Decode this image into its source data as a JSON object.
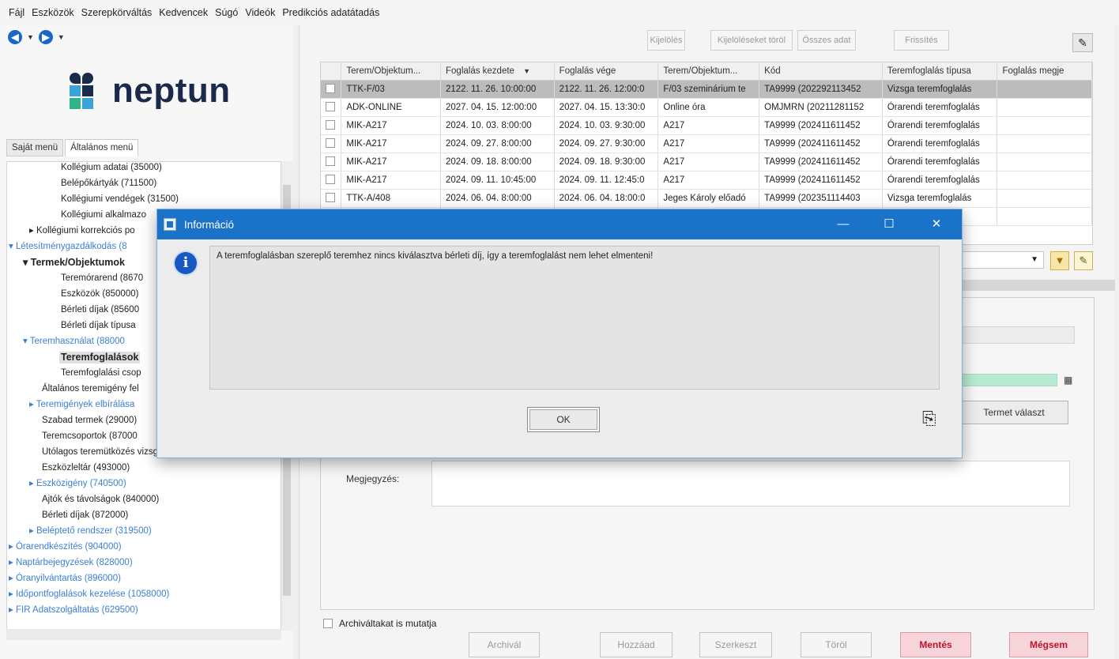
{
  "menubar": {
    "items": [
      "Fájl",
      "Eszközök",
      "Szerepkörváltás",
      "Kedvencek",
      "Súgó",
      "Videók",
      "Predikciós adatátadás"
    ]
  },
  "logo": {
    "text": "neptun"
  },
  "left_tabs": [
    "Saját menü",
    "Általános menü"
  ],
  "tree": {
    "items": [
      "Kollégium adatai (35000)",
      "Belépőkártyák (711500)",
      "Kollégiumi vendégek (31500)",
      "Kollégiumi alkalmazo",
      "Kollégiumi korrekciós po",
      "Létesítménygazdálkodás (8",
      "Termek/Objektumok",
      "Teremórarend (8670",
      "Eszközök (850000)",
      "Bérleti díjak (85600",
      "Bérleti díjak típusa",
      "Teremhasználat (88000",
      "Teremfoglalások",
      "Teremfoglalási csop",
      "Általános teremigény fel",
      "Teremigények elbírálása",
      "Szabad termek (29000)",
      "Teremcsoportok (87000",
      "Utólagos teremütközés vizsgálat (80500)",
      "Eszközleltár (493000)",
      "Eszközigény (740500)",
      "Ajtók és távolságok (840000)",
      "Bérleti díjak (872000)",
      "Beléptető rendszer (319500)",
      "Órarendkészítés (904000)",
      "Naptárbejegyzések (828000)",
      "Óranyilvántartás (896000)",
      "Időpontfoglalások kezelése (1058000)",
      "FIR Adatszolgáltatás (629500)"
    ]
  },
  "toolbar": {
    "kijeloles": "Kijelölés",
    "kijeloleseket_torol": "Kijelöléseket töröl",
    "osszes_adat": "Összes adat",
    "frissites": "Frissítés"
  },
  "grid": {
    "columns": [
      "Terem/Objektum...",
      "Foglalás kezdete",
      "Foglalás vége",
      "Terem/Objektum...",
      "Kód",
      "Teremfoglalás típusa",
      "Foglalás megje"
    ],
    "rows": [
      [
        "TTK-F/03",
        "2122. 11. 26. 10:00:00",
        "2122. 11. 26. 12:00:0",
        "F/03 szeminárium te",
        "TA9999 (202292113452",
        "Vizsga teremfoglalás",
        ""
      ],
      [
        "ADK-ONLINE",
        "2027. 04. 15. 12:00:00",
        "2027. 04. 15. 13:30:0",
        "Online óra",
        "OMJMRN (20211281152",
        "Órarendi teremfoglalás",
        ""
      ],
      [
        "MIK-A217",
        "2024. 10. 03. 8:00:00",
        "2024. 10. 03. 9:30:00",
        "A217",
        "TA9999 (202411611452",
        "Órarendi teremfoglalás",
        ""
      ],
      [
        "MIK-A217",
        "2024. 09. 27. 8:00:00",
        "2024. 09. 27. 9:30:00",
        "A217",
        "TA9999 (202411611452",
        "Órarendi teremfoglalás",
        ""
      ],
      [
        "MIK-A217",
        "2024. 09. 18. 8:00:00",
        "2024. 09. 18. 9:30:00",
        "A217",
        "TA9999 (202411611452",
        "Órarendi teremfoglalás",
        ""
      ],
      [
        "MIK-A217",
        "2024. 09. 11. 10:45:00",
        "2024. 09. 11. 12:45:0",
        "A217",
        "TA9999 (202411611452",
        "Órarendi teremfoglalás",
        ""
      ],
      [
        "TTK-A/408",
        "2024. 06. 04. 8:00:00",
        "2024. 06. 04. 18:00:0",
        "Jeges Károly előadó",
        "TA9999 (202351114403",
        "Vizsga teremfoglalás",
        ""
      ],
      [
        "",
        "",
        "",
        "",
        "",
        "foglalás",
        ""
      ]
    ]
  },
  "detail": {
    "terem_valaszt": "Termet választ",
    "megjegyzes_label": "Megjegyzés:",
    "archiv_checkbox": "Archiváltakat is mutatja"
  },
  "bottom_buttons": {
    "archival": "Archivál",
    "hozzaad": "Hozzáad",
    "szerkeszt": "Szerkeszt",
    "torol": "Töröl",
    "mentes": "Mentés",
    "megsem": "Mégsem"
  },
  "dialog": {
    "title": "Információ",
    "message": "A teremfoglalásban szereplő teremhez nincs kiválasztva bérleti díj, így a teremfoglalást nem lehet elmenteni!",
    "ok": "OK"
  },
  "colors": {
    "title_bar": "#1a73c8",
    "save_button_bg": "#f6d4d9",
    "save_button_text": "#c0142c",
    "link_tree_text": "#3a7fd5"
  }
}
